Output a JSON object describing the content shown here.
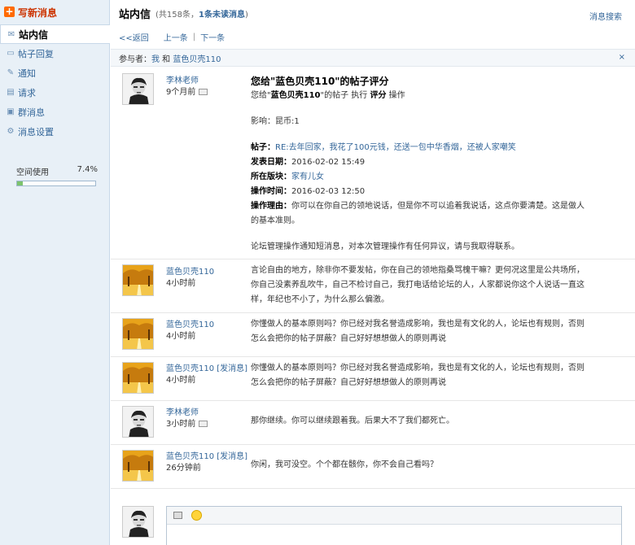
{
  "sidebar": {
    "compose_label": "写新消息",
    "items": [
      {
        "label": "站内信",
        "icon": "envelope-icon"
      },
      {
        "label": "帖子回复",
        "icon": "comment-icon"
      },
      {
        "label": "通知",
        "icon": "pencil-icon"
      },
      {
        "label": "请求",
        "icon": "document-icon"
      },
      {
        "label": "群消息",
        "icon": "group-chat-icon"
      },
      {
        "label": "消息设置",
        "icon": "settings-chat-icon"
      }
    ],
    "space": {
      "label": "空间使用",
      "percent_text": "7.4%",
      "percent": 7.4
    }
  },
  "header": {
    "title": "站内信",
    "count_prefix": "(共158条，",
    "unread": "1条未读消息",
    "count_suffix": ")",
    "search": "消息搜索"
  },
  "navbar": {
    "back": "<<返回",
    "prev": "上一条",
    "sep": "|",
    "next": "下一条"
  },
  "participants": {
    "prefix": "参与者：",
    "me": "我",
    "and": " 和 ",
    "other": "蓝色贝壳110",
    "close": "×"
  },
  "messages": [
    {
      "author": "李林老师",
      "time": "9个月前",
      "title": "您给\"蓝色贝壳110\"的帖子评分",
      "line1_pre": "您给\"",
      "line1_user": "蓝色贝壳110",
      "line1_mid": "\"的帖子 执行 ",
      "line1_op": "评分",
      "line1_post": " 操作",
      "influence": "影响：昆币:1",
      "post_label": "帖子：",
      "post_link": "RE:去年回家，我花了100元钱，还送一包中华香烟，还被人家嘲笑",
      "date_label": "发表日期：",
      "date_value": "2016-02-02 15:49",
      "board_label": "所在版块：",
      "board_link": "家有儿女",
      "optime_label": "操作时间：",
      "optime_value": "2016-02-03 12:50",
      "reason_label": "操作理由：",
      "reason_text": "你可以在你自己的领地说话，但是你不可以追着我说话，这点你要清楚。这是做人的基本准则。",
      "footer": "论坛管理操作通知短消息，对本次管理操作有任何异议，请与我取得联系。"
    },
    {
      "author": "蓝色贝壳110",
      "time": "4小时前",
      "text": "言论自由的地方，除非你不要发帖，你在自己的领地指桑骂槐干嘛？更何况这里是公共场所，你自己没素养乱吹牛，自己不检讨自己，我打电话给论坛的人，人家都说你这个人说话一直这样，年纪也不小了，为什么那么偏激。"
    },
    {
      "author": "蓝色贝壳110",
      "time": "4小时前",
      "text": "你懂做人的基本原则吗？你已经对我名誉造成影响，我也是有文化的人，论坛也有规则，否则怎么会把你的帖子屏蔽？自己好好想想做人的原则再说"
    },
    {
      "author": "蓝色贝壳110",
      "send": "[发消息]",
      "time": "4小时前",
      "text": "你懂做人的基本原则吗？你已经对我名誉造成影响，我也是有文化的人，论坛也有规则，否则怎么会把你的帖子屏蔽？自己好好想想做人的原则再说"
    },
    {
      "author": "李林老师",
      "time": "3小时前",
      "text": "那你继续。你可以继续跟着我。后果大不了我们都死亡。"
    },
    {
      "author": "蓝色贝壳110",
      "send": "[发消息]",
      "time": "26分钟前",
      "text": "你闲，我可没空。个个都在骸你，你不会自己看吗？"
    }
  ],
  "colors": {
    "accent": "#336699",
    "compose": "#cc3300",
    "sidebar_bg": "#e8f0f7"
  }
}
